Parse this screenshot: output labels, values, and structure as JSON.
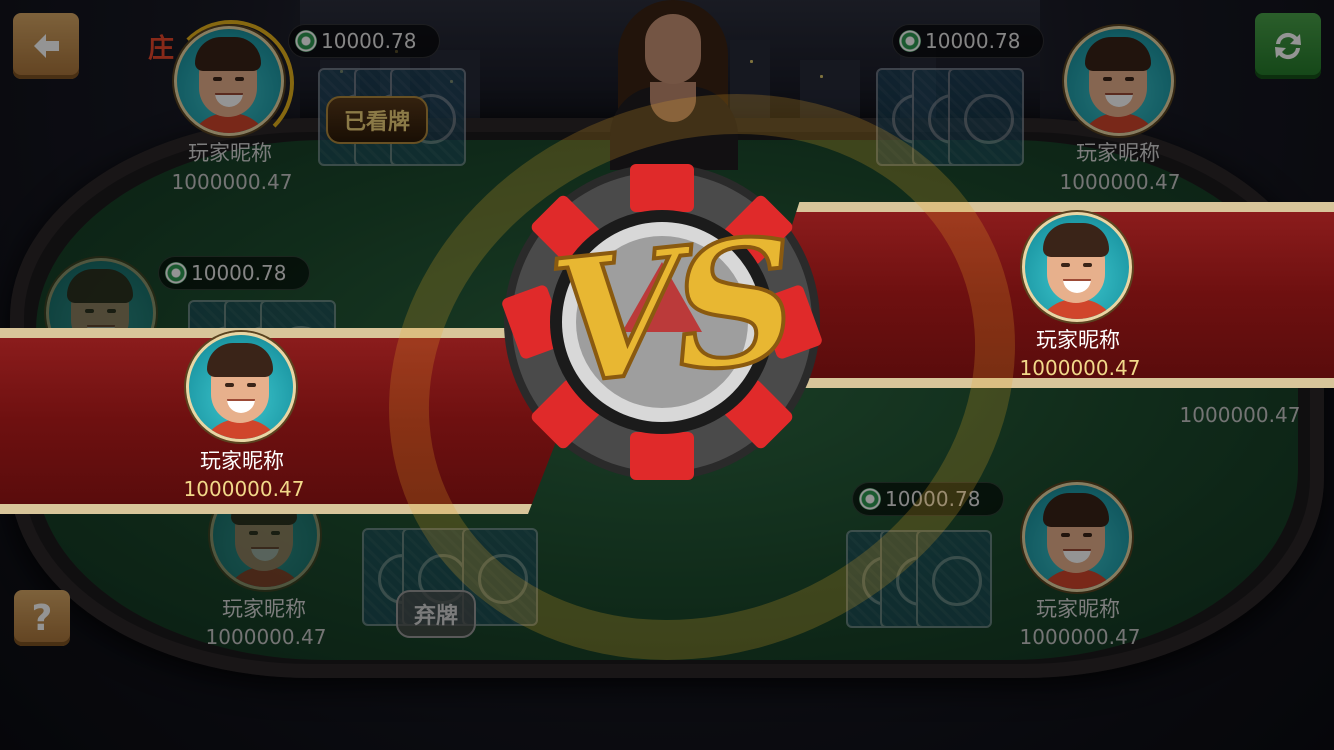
{
  "top_bar": {
    "back_icon": "arrow-left-icon",
    "refresh_icon": "refresh-icon",
    "help_label": "?"
  },
  "banker_label": "庄",
  "seats": [
    {
      "name": "玩家昵称",
      "money": "1000000.47",
      "bet": "10000.78",
      "status": "已看牌"
    },
    {
      "name": "玩家昵称",
      "money": "1000000.47",
      "bet": "10000.78"
    },
    {
      "name": "玩家昵称",
      "money": "",
      "bet": "10000.78"
    },
    {
      "name": "玩家昵称",
      "money": "1000000.47",
      "bet": "",
      "status": "弃牌"
    },
    {
      "name": "玩家昵称",
      "money": "1000000.47",
      "bet": "10000.78"
    },
    {
      "money": "1000000.47"
    }
  ],
  "vs": {
    "label": "VS",
    "left_player": {
      "name": "玩家昵称",
      "money": "1000000.47"
    },
    "right_player": {
      "name": "玩家昵称",
      "money": "1000000.47"
    }
  },
  "colors": {
    "banner_red": "#7a1414",
    "gold": "#e8b732",
    "felt_green": "#1c4a2d"
  }
}
